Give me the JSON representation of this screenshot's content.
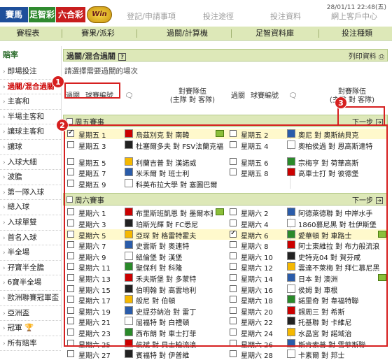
{
  "header": {
    "tabs": [
      "賽馬",
      "足智彩",
      "六合彩"
    ],
    "logo_text": "Win",
    "links": [
      "登記/申請事項",
      "投注途徑",
      "投注資料",
      "網上客戶中心"
    ],
    "datetime": "28/01/11 22:48(五)"
  },
  "nav": {
    "items": [
      "賽程表",
      "賽果/派彩",
      "過關/計算機",
      "足智資料庫",
      "投注種類"
    ]
  },
  "sidebar": {
    "heading": "賠率",
    "items": [
      "即場投注",
      "過關/混合過關",
      "主客和",
      "半場主客和",
      "讓球主客和",
      "讓球",
      "入球大細",
      "波膽",
      "第一隊入球",
      "總入球",
      "入球單雙",
      "首名入球",
      "半全場",
      "孖寶半全膽",
      "6寶半全場",
      "歐洲聯賽冠軍盃",
      "亞洲盃",
      "冠軍",
      "所有賠率"
    ]
  },
  "main": {
    "title": "過關/混合過關",
    "print_label": "列印資料",
    "hint": "請選擇需要過關的場次",
    "col_headers": {
      "pass": "過關",
      "match_no": "球賽編號",
      "teams": "對賽隊伍",
      "teams_sub": "(主隊 對 客隊)"
    },
    "sections": [
      {
        "label": "周五賽事",
        "next": "下一步",
        "rows": [
          {
            "l": {
              "day": "星期五 1",
              "match": "烏茲別克 對 南韓",
              "on": true,
              "tv": true
            },
            "r": {
              "day": "星期五 2",
              "match": "奧尼 對 奧斯納貝克",
              "on": false,
              "tv": false
            },
            "hl": true
          },
          {
            "l": {
              "day": "星期五 3",
              "match": "杜塞爾多夫 對 FSV法蘭克福",
              "on": false,
              "tv": false
            },
            "r": {
              "day": "星期五 4",
              "match": "奧柏侯過 對 恩高斯達特",
              "on": false,
              "tv": false
            },
            "hl": false
          },
          {
            "l": {
              "day": "星期五 5",
              "match": "利蘭吉普 對 漢諾威",
              "on": false,
              "tv": false
            },
            "r": {
              "day": "星期五 6",
              "match": "宗梅亨 對 荷華高斯",
              "on": false,
              "tv": false
            },
            "hl": false
          },
          {
            "l": {
              "day": "星期五 7",
              "match": "米禾爾 對 班士利",
              "on": false,
              "tv": false
            },
            "r": {
              "day": "星期五 8",
              "match": "高車士打 對 彼德堡",
              "on": false,
              "tv": false
            },
            "hl": false
          },
          {
            "l": {
              "day": "星期五 9",
              "match": "科英布拉大學 對 塞圖巴爾",
              "on": false,
              "tv": false
            },
            "r": null,
            "hl": false
          }
        ]
      },
      {
        "label": "周六賽事",
        "next": "下一步",
        "rows": [
          {
            "l": {
              "day": "星期六 1",
              "match": "布里斯班凱恩 對 墨爾本勝利",
              "on": false,
              "tv": true
            },
            "r": {
              "day": "星期六 2",
              "match": "阿德萊德聯 對 中岸水手",
              "on": false,
              "tv": false
            },
            "hl": false
          },
          {
            "l": {
              "day": "星期六 3",
              "match": "珀斯光輝 對 FC悉尼",
              "on": false,
              "tv": false
            },
            "r": {
              "day": "星期六 4",
              "match": "1860慕尼黑 對 杜伊斯堡",
              "on": false,
              "tv": false
            },
            "hl": false
          },
          {
            "l": {
              "day": "星期六 5",
              "match": "亞琛 對 格雷特霍夫",
              "on": false,
              "tv": false
            },
            "r": {
              "day": "星期六 6",
              "match": "愛華頓 對 車路士",
              "on": true,
              "tv": true
            },
            "hl": true
          },
          {
            "l": {
              "day": "星期六 7",
              "match": "史雲斯 對 奧連特",
              "on": false,
              "tv": false
            },
            "r": {
              "day": "星期六 8",
              "match": "阿士東維拉 對 布力般流浪",
              "on": false,
              "tv": false
            },
            "hl": false
          },
          {
            "l": {
              "day": "星期六 9",
              "match": "紐倫堡 對 漢堡",
              "on": false,
              "tv": false
            },
            "r": {
              "day": "星期六 10",
              "match": "史特克04 對 賀芬咸",
              "on": false,
              "tv": false
            },
            "hl": false
          },
          {
            "l": {
              "day": "星期六 11",
              "match": "聖保利 對 科隆",
              "on": false,
              "tv": false
            },
            "r": {
              "day": "星期六 12",
              "match": "雲達不萊梅 對 拜仁慕尼黑",
              "on": false,
              "tv": false
            },
            "hl": false
          },
          {
            "l": {
              "day": "星期六 13",
              "match": "禾夫斯堡 對 多蒙特",
              "on": false,
              "tv": false
            },
            "r": {
              "day": "星期六 14",
              "match": "日本 對 澳洲",
              "on": false,
              "tv": true
            },
            "hl": false
          },
          {
            "l": {
              "day": "星期六 15",
              "match": "伯明翰 對 高雲地利",
              "on": false,
              "tv": false
            },
            "r": {
              "day": "星期六 16",
              "match": "侯姆 對 車根",
              "on": false,
              "tv": false
            },
            "hl": false
          },
          {
            "l": {
              "day": "星期六 17",
              "match": "般尼 對 伯頓",
              "on": false,
              "tv": false
            },
            "r": {
              "day": "星期六 18",
              "match": "諾里奇 對 韋福特聯",
              "on": false,
              "tv": false
            },
            "hl": false
          },
          {
            "l": {
              "day": "星期六 19",
              "match": "史提芬納治 對 雷丁",
              "on": false,
              "tv": false
            },
            "r": {
              "day": "星期六 20",
              "match": "錫周三 對 希斯",
              "on": false,
              "tv": false
            },
            "hl": false
          },
          {
            "l": {
              "day": "星期六 21",
              "match": "屈福特 對 白禮頓",
              "on": false,
              "tv": false
            },
            "r": {
              "day": "星期六 22",
              "match": "托基聯 對 卡維尼",
              "on": false,
              "tv": false
            },
            "hl": false
          },
          {
            "l": {
              "day": "星期六 23",
              "match": "西布朗 對 車士打菲",
              "on": false,
              "tv": false
            },
            "r": {
              "day": "星期六 24",
              "match": "水晶宮 對 諾域治",
              "on": false,
              "tv": false
            },
            "hl": false
          },
          {
            "l": {
              "day": "星期六 25",
              "match": "侯斌 對 貝士柏流浪",
              "on": false,
              "tv": false
            },
            "r": {
              "day": "星期六 26",
              "match": "斯肯索普 對 雪菲斯聯",
              "on": false,
              "tv": false
            },
            "hl": false
          },
          {
            "l": {
              "day": "星期六 27",
              "match": "賓福特 對 伊普維",
              "on": false,
              "tv": false
            },
            "r": {
              "day": "星期六 28",
              "match": "卡素爾 對 邦士",
              "on": false,
              "tv": false
            },
            "hl": false
          }
        ]
      }
    ]
  },
  "callouts": [
    "1",
    "2",
    "3"
  ]
}
